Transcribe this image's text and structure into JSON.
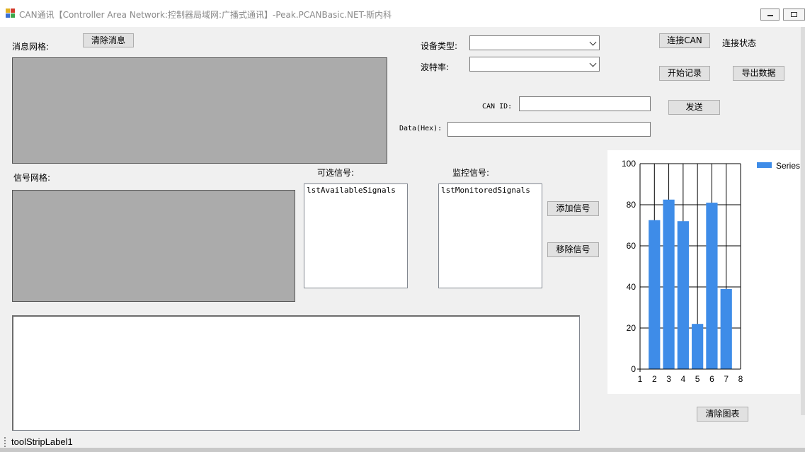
{
  "window": {
    "title": "CAN通讯【Controller Area Network:控制器局域网:广播式通讯】-Peak.PCANBasic.NET-斯内科"
  },
  "messages": {
    "label": "消息网格:",
    "clear_button": "清除消息"
  },
  "signals": {
    "label": "信号网格:",
    "available_label": "可选信号:",
    "available_list": "lstAvailableSignals",
    "monitored_label": "监控信号:",
    "monitored_list": "lstMonitoredSignals",
    "add_button": "添加信号",
    "remove_button": "移除信号"
  },
  "device": {
    "type_label": "设备类型:",
    "type_value": "",
    "baud_label": "波特率:",
    "baud_value": "",
    "connect_button": "连接CAN",
    "status_text": "连接状态",
    "start_record_button": "开始记录",
    "export_button": "导出数据"
  },
  "send": {
    "can_id_label": "CAN ID:",
    "can_id_value": "",
    "data_label": "Data(Hex):",
    "data_value": "",
    "send_button": "发送"
  },
  "chart": {
    "clear_button": "清除图表"
  },
  "chart_data": {
    "type": "bar",
    "x": [
      2,
      3,
      4,
      5,
      6,
      7
    ],
    "values": [
      72.5,
      82.5,
      72,
      22,
      81,
      39
    ],
    "series": [
      {
        "name": "Series",
        "values": [
          72.5,
          82.5,
          72,
          22,
          81,
          39
        ]
      }
    ],
    "xlim": [
      1,
      8
    ],
    "ylim": [
      0,
      100
    ],
    "xticks": [
      "1",
      "2",
      "3",
      "4",
      "5",
      "6",
      "7",
      "8"
    ],
    "yticks": [
      "0",
      "20",
      "40",
      "60",
      "80",
      "100"
    ],
    "grid": true,
    "legend": "top-right",
    "color": "#3e8ce8"
  },
  "status": {
    "label": "toolStripLabel1"
  }
}
